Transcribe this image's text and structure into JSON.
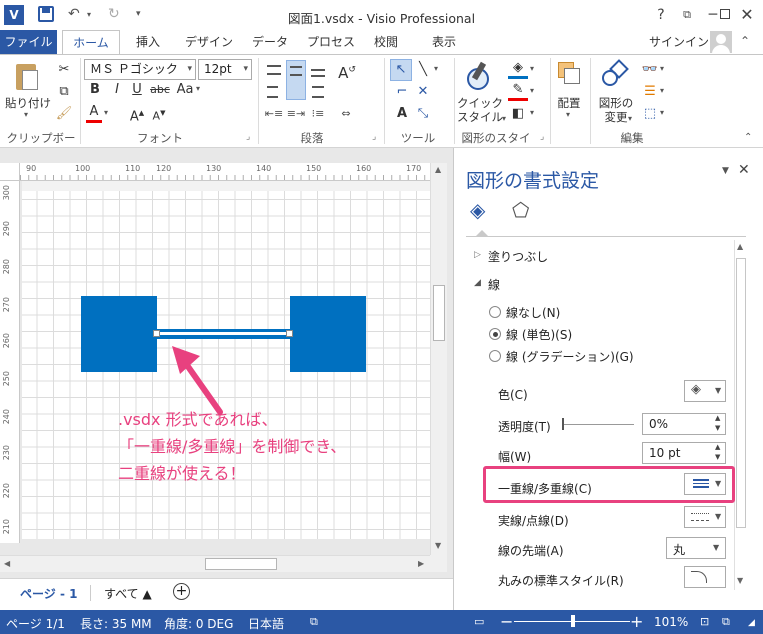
{
  "window": {
    "title": "図面1.vsdx - Visio Professional",
    "help": "?",
    "app_badge": "V"
  },
  "tabs": {
    "file": "ファイル",
    "items": [
      "ホーム",
      "挿入",
      "デザイン",
      "データ",
      "プロセス",
      "校閲",
      "表示"
    ],
    "signin": "サインイン"
  },
  "ribbon": {
    "clipboard": {
      "paste": "貼り付け",
      "label": "クリップボード"
    },
    "font": {
      "name": "ＭＳ Ｐゴシック",
      "size": "12pt",
      "label": "フォント",
      "bold": "B",
      "italic": "I",
      "underline": "U",
      "strike": "abc",
      "aa": "Aa",
      "grow": "A",
      "shrink": "A",
      "color": "A"
    },
    "paragraph": {
      "label": "段落"
    },
    "tools": {
      "label": "ツール"
    },
    "shapestyle": {
      "quick": "クイック",
      "style": "スタイル",
      "label": "図形のスタイル"
    },
    "arrange": {
      "label1": "配置"
    },
    "edit": {
      "change1": "図形の",
      "change2": "変更",
      "label": "編集"
    }
  },
  "ruler": {
    "h": [
      "90",
      "100",
      "110",
      "120",
      "130",
      "140",
      "150",
      "160",
      "170"
    ],
    "v": [
      "300",
      "290",
      "280",
      "270",
      "260",
      "250",
      "240",
      "230",
      "220",
      "210"
    ]
  },
  "annotation": {
    "line1": ".vsdx 形式であれば、",
    "line2": "「一重線/多重線」を制御でき、",
    "line3": "二重線が使える！",
    "color": "#e8417f"
  },
  "pagebar": {
    "page": "ページ - 1",
    "all": "すべて ▲",
    "add": "+"
  },
  "pane": {
    "title": "図形の書式設定",
    "fill": "塗りつぶし",
    "line": "線",
    "radio_none": "線なし(N)",
    "radio_solid": "線 (単色)(S)",
    "radio_grad": "線 (グラデーション)(G)",
    "color": "色(C)",
    "transparency": "透明度(T)",
    "transparency_val": "0%",
    "width": "幅(W)",
    "width_val": "10 pt",
    "compound": "一重線/多重線(C)",
    "dash": "実線/点線(D)",
    "cap": "線の先端(A)",
    "cap_val": "丸",
    "round": "丸みの標準スタイル(R)",
    "highlight": "#e8417f"
  },
  "status": {
    "page": "ページ 1/1",
    "length": "長さ: 35 MM",
    "angle": "角度: 0 DEG",
    "lang": "日本語",
    "zoom": "101%"
  },
  "colors": {
    "accent": "#2b58a5",
    "shape": "#0070c0"
  }
}
